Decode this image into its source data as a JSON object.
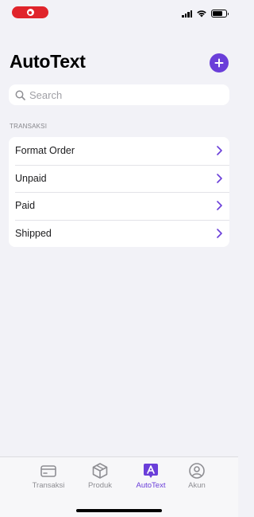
{
  "colors": {
    "accent": "#6a3ed9",
    "recording": "#e0242b",
    "background": "#f2f2f7",
    "tab_inactive": "#8e8e93"
  },
  "header": {
    "title": "AutoText",
    "add_icon": "plus-icon"
  },
  "search": {
    "placeholder": "Search",
    "value": "",
    "icon": "magnifier-icon"
  },
  "section": {
    "header": "TRANSAKSI",
    "items": [
      {
        "label": "Format Order",
        "icon": "chevron-right-icon"
      },
      {
        "label": "Unpaid",
        "icon": "chevron-right-icon"
      },
      {
        "label": "Paid",
        "icon": "chevron-right-icon"
      },
      {
        "label": "Shipped",
        "icon": "chevron-right-icon"
      }
    ]
  },
  "tabbar": {
    "active": "AutoText",
    "tabs": [
      {
        "label": "Transaksi",
        "icon": "credit-card-icon"
      },
      {
        "label": "Produk",
        "icon": "box-icon"
      },
      {
        "label": "AutoText",
        "icon": "autotext-icon"
      },
      {
        "label": "Akun",
        "icon": "person-circle-icon"
      }
    ]
  },
  "status_bar": {
    "signal_bars": 4,
    "battery_level": 0.75,
    "icons": [
      "recording-indicator-icon",
      "signal-icon",
      "wifi-icon",
      "battery-icon"
    ]
  }
}
